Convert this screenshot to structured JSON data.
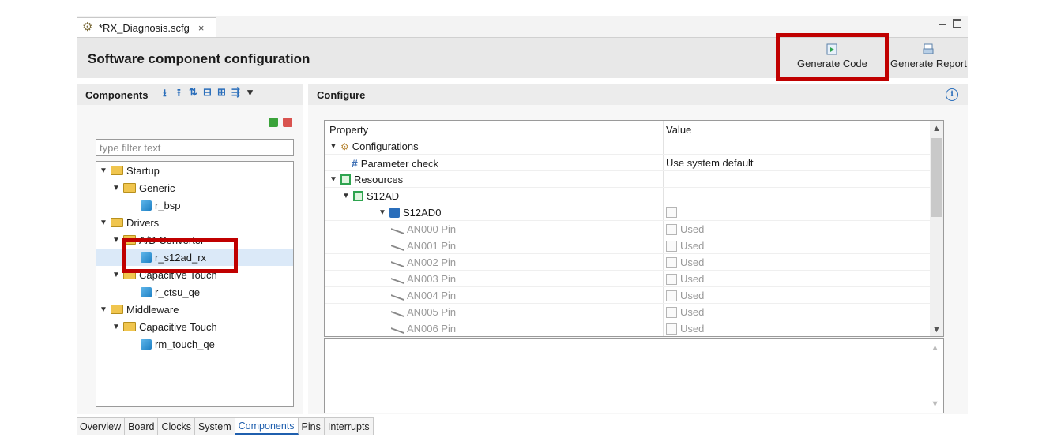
{
  "editor": {
    "tab_title": "*RX_Diagnosis.scfg",
    "close_glyph": "×"
  },
  "header": {
    "title": "Software component configuration",
    "generate_code": "Generate Code",
    "generate_report": "Generate Report"
  },
  "components": {
    "title": "Components",
    "filter_placeholder": "type filter text",
    "tree": [
      {
        "label": "Startup"
      },
      {
        "label": "Generic"
      },
      {
        "label": "r_bsp"
      },
      {
        "label": "Drivers"
      },
      {
        "label": "A/D Converter"
      },
      {
        "label": "r_s12ad_rx"
      },
      {
        "label": "Capacitive Touch"
      },
      {
        "label": "r_ctsu_qe"
      },
      {
        "label": "Middleware"
      },
      {
        "label": "Capacitive Touch"
      },
      {
        "label": "rm_touch_qe"
      }
    ]
  },
  "configure": {
    "title": "Configure",
    "col_property": "Property",
    "col_value": "Value",
    "rows": [
      {
        "name": "Configurations",
        "value": ""
      },
      {
        "name": "Parameter check",
        "value": "Use system default"
      },
      {
        "name": "Resources",
        "value": ""
      },
      {
        "name": "S12AD",
        "value": ""
      },
      {
        "name": "S12AD0",
        "value": ""
      },
      {
        "name": "AN000 Pin",
        "value": "Used"
      },
      {
        "name": "AN001 Pin",
        "value": "Used"
      },
      {
        "name": "AN002 Pin",
        "value": "Used"
      },
      {
        "name": "AN003 Pin",
        "value": "Used"
      },
      {
        "name": "AN004 Pin",
        "value": "Used"
      },
      {
        "name": "AN005 Pin",
        "value": "Used"
      },
      {
        "name": "AN006 Pin",
        "value": "Used"
      }
    ]
  },
  "bottom_tabs": [
    "Overview",
    "Board",
    "Clocks",
    "System",
    "Components",
    "Pins",
    "Interrupts"
  ],
  "colors": {
    "highlight": "#c00000",
    "active_tab": "#1f5fae",
    "selection": "#dbe9f8"
  }
}
